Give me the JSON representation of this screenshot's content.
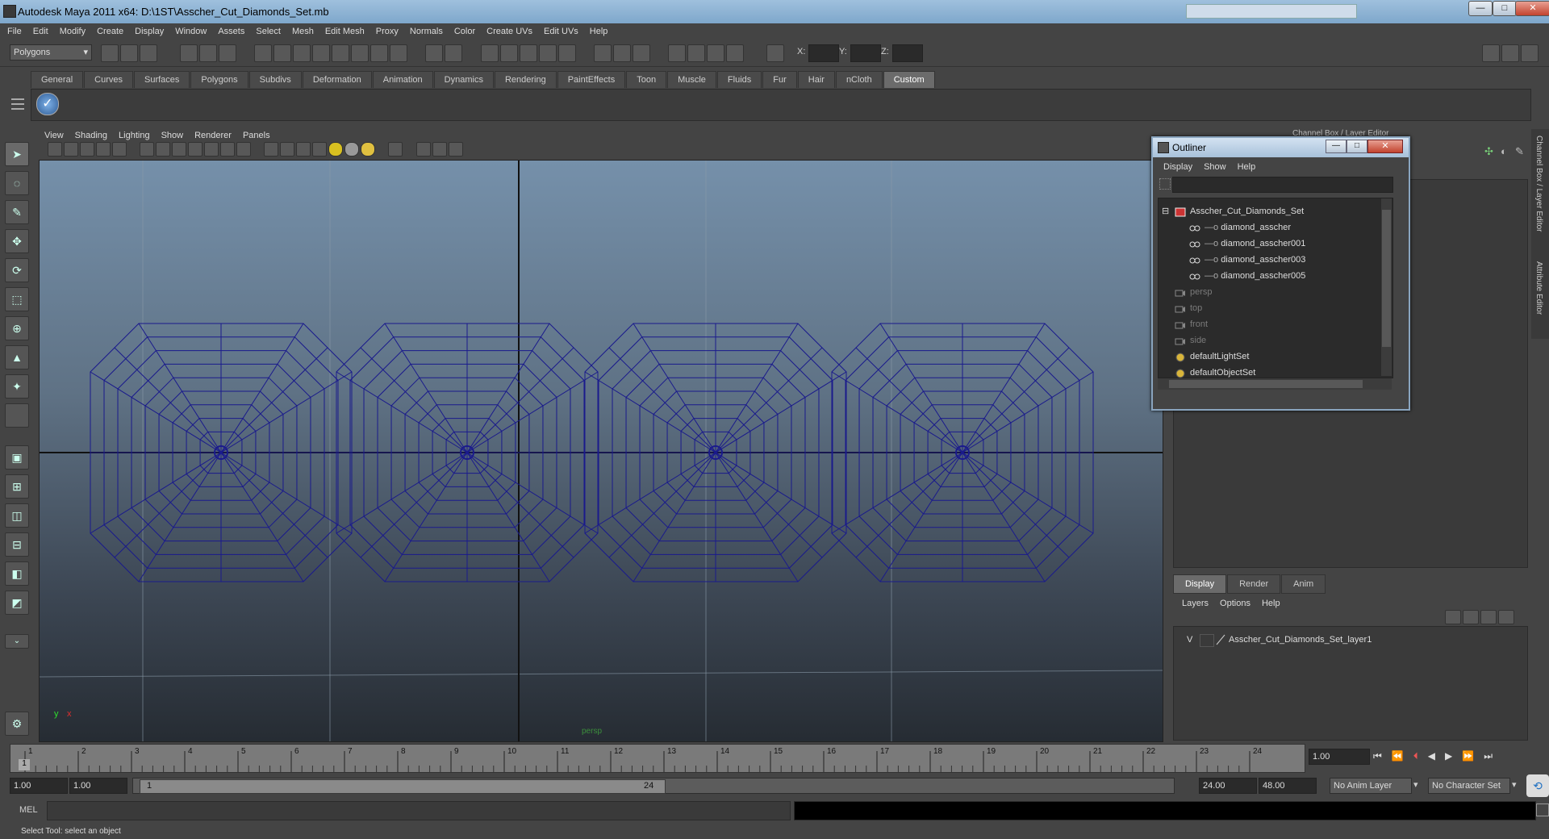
{
  "window": {
    "title": "Autodesk Maya 2011 x64: D:\\1ST\\Asscher_Cut_Diamonds_Set.mb",
    "min": "—",
    "max": "□",
    "close": "✕"
  },
  "menubar": [
    "File",
    "Edit",
    "Modify",
    "Create",
    "Display",
    "Window",
    "Assets",
    "Select",
    "Mesh",
    "Edit Mesh",
    "Proxy",
    "Normals",
    "Color",
    "Create UVs",
    "Edit UVs",
    "Help"
  ],
  "status": {
    "mode": "Polygons",
    "x_label": "X:",
    "y_label": "Y:",
    "z_label": "Z:"
  },
  "shelf": {
    "tabs": [
      "General",
      "Curves",
      "Surfaces",
      "Polygons",
      "Subdivs",
      "Deformation",
      "Animation",
      "Dynamics",
      "Rendering",
      "PaintEffects",
      "Toon",
      "Muscle",
      "Fluids",
      "Fur",
      "Hair",
      "nCloth",
      "Custom"
    ],
    "active": "Custom"
  },
  "viewport": {
    "menus": [
      "View",
      "Shading",
      "Lighting",
      "Show",
      "Renderer",
      "Panels"
    ],
    "camera_label": "persp",
    "axis_y": "y",
    "axis_x": "x",
    "wire_color": "#1a1a8c"
  },
  "outliner": {
    "title": "Outliner",
    "menus": [
      "Display",
      "Show",
      "Help"
    ],
    "items": [
      {
        "label": "Asscher_Cut_Diamonds_Set",
        "indent": 0,
        "dim": false,
        "icon": "set-icon"
      },
      {
        "label": "diamond_asscher",
        "indent": 1,
        "dim": false,
        "icon": "mesh-icon"
      },
      {
        "label": "diamond_asscher001",
        "indent": 1,
        "dim": false,
        "icon": "mesh-icon"
      },
      {
        "label": "diamond_asscher003",
        "indent": 1,
        "dim": false,
        "icon": "mesh-icon"
      },
      {
        "label": "diamond_asscher005",
        "indent": 1,
        "dim": false,
        "icon": "mesh-icon"
      },
      {
        "label": "persp",
        "indent": 0,
        "dim": true,
        "icon": "camera-icon"
      },
      {
        "label": "top",
        "indent": 0,
        "dim": true,
        "icon": "camera-icon"
      },
      {
        "label": "front",
        "indent": 0,
        "dim": true,
        "icon": "camera-icon"
      },
      {
        "label": "side",
        "indent": 0,
        "dim": true,
        "icon": "camera-icon"
      },
      {
        "label": "defaultLightSet",
        "indent": 0,
        "dim": false,
        "icon": "lightset-icon"
      },
      {
        "label": "defaultObjectSet",
        "indent": 0,
        "dim": false,
        "icon": "objectset-icon"
      }
    ]
  },
  "channelbox": {
    "title": "Channel Box / Layer Editor",
    "vtab1": "Channel Box / Layer Editor",
    "vtab2": "Attribute Editor"
  },
  "layers": {
    "tabs": [
      "Display",
      "Render",
      "Anim"
    ],
    "active": "Display",
    "menus": [
      "Layers",
      "Options",
      "Help"
    ],
    "layer_vis": "V",
    "layer_name": "Asscher_Cut_Diamonds_Set_layer1"
  },
  "timeline": {
    "ticks": [
      "1",
      "2",
      "3",
      "4",
      "5",
      "6",
      "7",
      "8",
      "9",
      "10",
      "11",
      "12",
      "13",
      "14",
      "15",
      "16",
      "17",
      "18",
      "19",
      "20",
      "21",
      "22",
      "23",
      "24"
    ],
    "current": "1",
    "current_time": "1.00"
  },
  "range": {
    "start": "1.00",
    "playback_start": "1.00",
    "slider_start": "1",
    "slider_end": "24",
    "playback_end": "24.00",
    "end": "48.00",
    "anim_layer": "No Anim Layer",
    "char_set": "No Character Set"
  },
  "cmdline": {
    "label": "MEL"
  },
  "helpline": {
    "text": "Select Tool: select an object"
  }
}
